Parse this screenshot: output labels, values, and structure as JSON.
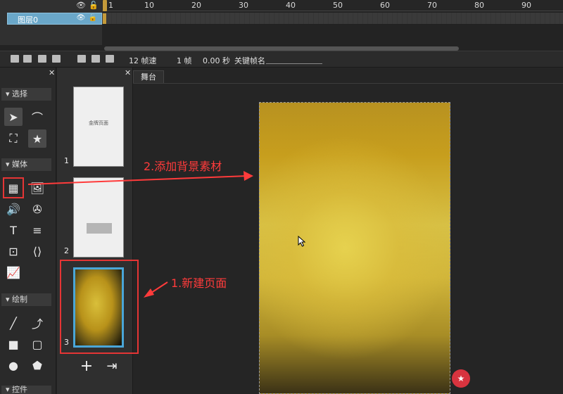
{
  "timeline": {
    "layer_name": "图层0",
    "ruler_numbers": [
      "1",
      "10",
      "20",
      "30",
      "40",
      "50",
      "60",
      "70",
      "80",
      "90"
    ]
  },
  "toolbar": {
    "frame_rate": "12 帧速",
    "frame": "1 帧",
    "time": "0.00 秒",
    "keyframe_name_label": "关键帧名"
  },
  "tools": {
    "section_select": "选择",
    "section_media": "媒体",
    "section_draw": "绘制",
    "section_more": "控件"
  },
  "pages": {
    "items": [
      {
        "number": "1",
        "text": "金牌页面"
      },
      {
        "number": "2",
        "text": ""
      },
      {
        "number": "3",
        "text": ""
      }
    ]
  },
  "stage": {
    "tab_label": "舞台"
  },
  "annotations": {
    "step1": "1.新建页面",
    "step2": "2.添加背景素材",
    "color": "#ff3b3b"
  }
}
